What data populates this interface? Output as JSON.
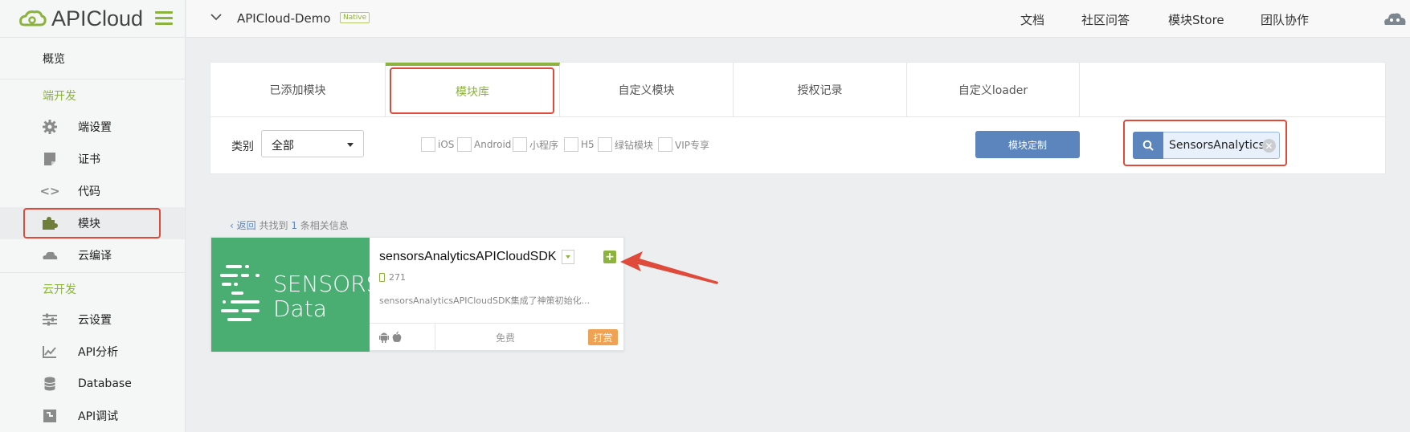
{
  "brand": {
    "name": "APICloud",
    "accent": "#8cb33e"
  },
  "sidebar": {
    "items": [
      {
        "label": "概览",
        "icon": ""
      },
      {
        "section": "端开发"
      },
      {
        "label": "端设置",
        "icon": "gear-icon"
      },
      {
        "label": "证书",
        "icon": "certificate-icon"
      },
      {
        "label": "代码",
        "icon": "code-icon"
      },
      {
        "label": "模块",
        "icon": "puzzle-icon"
      },
      {
        "label": "云编译",
        "icon": "cloud-icon"
      },
      {
        "section": "云开发"
      },
      {
        "label": "云设置",
        "icon": "sliders-icon"
      },
      {
        "label": "API分析",
        "icon": "chart-line-icon"
      },
      {
        "label": "Database",
        "icon": "database-icon"
      },
      {
        "label": "API调试",
        "icon": "debug-icon"
      }
    ]
  },
  "header": {
    "app_name": "APICloud-Demo",
    "badge": "Native",
    "links": [
      "文档",
      "社区问答",
      "模块Store",
      "团队协作"
    ]
  },
  "tabs": [
    "已添加模块",
    "模块库",
    "自定义模块",
    "授权记录",
    "自定义loader"
  ],
  "active_tab": "模块库",
  "filter": {
    "category_label": "类别",
    "category_value": "全部",
    "checkboxes": [
      "iOS",
      "Android",
      "小程序",
      "H5",
      "绿钻模块",
      "VIP专享"
    ],
    "custom_button": "模块定制",
    "search_value": "SensorsAnalytics"
  },
  "results": {
    "back": "返回",
    "prefix": "共找到",
    "count": "1",
    "suffix": "条相关信息"
  },
  "card": {
    "logo_line1": "SENSORS",
    "logo_line2": "Data",
    "title": "sensorsAnalyticsAPICloudSDK",
    "downloads": "271",
    "description": "sensorsAnalyticsAPICloudSDK集成了神策初始化...",
    "price": "免费",
    "tip_button": "打赏"
  }
}
